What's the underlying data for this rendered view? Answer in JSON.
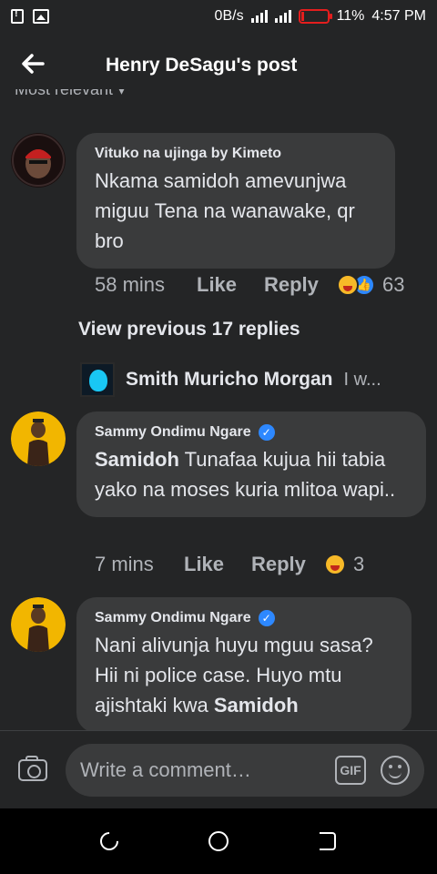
{
  "status_bar": {
    "speed": "0B/s",
    "battery": "11%",
    "battery_level": 0.11,
    "time": "4:57 PM"
  },
  "header": {
    "title": "Henry DeSagu's post",
    "back_icon": "arrow-left-icon"
  },
  "sort_label": "Most relevant",
  "comments": [
    {
      "author": "Vituko na ujinga by Kimeto",
      "verified": false,
      "text": "Nkama samidoh amevunjwa miguu Tena na wanawake, qr bro",
      "time": "58 mins",
      "like": "Like",
      "reply": "Reply",
      "reactions": [
        "haha",
        "like"
      ],
      "reaction_count": "63"
    },
    {
      "author": "Sammy Ondimu Ngare",
      "verified": true,
      "mention": "Samidoh",
      "text": " Tunafaa kujua hii tabia yako na moses kuria mlitoa wapi..",
      "time": "7 mins",
      "like": "Like",
      "reply": "Reply",
      "reactions": [
        "haha"
      ],
      "reaction_count": "3"
    },
    {
      "author": "Sammy Ondimu Ngare",
      "verified": true,
      "text": "Nani alivunja huyu mguu sasa? Hii ni police case. Huyo mtu ajishtaki kwa ",
      "mention": "Samidoh"
    }
  ],
  "view_previous": "View previous 17 replies",
  "reply_preview": {
    "name": "Smith Muricho Morgan",
    "snippet": "I w..."
  },
  "comment_input": {
    "placeholder": "Write a comment…",
    "gif_label": "GIF"
  }
}
